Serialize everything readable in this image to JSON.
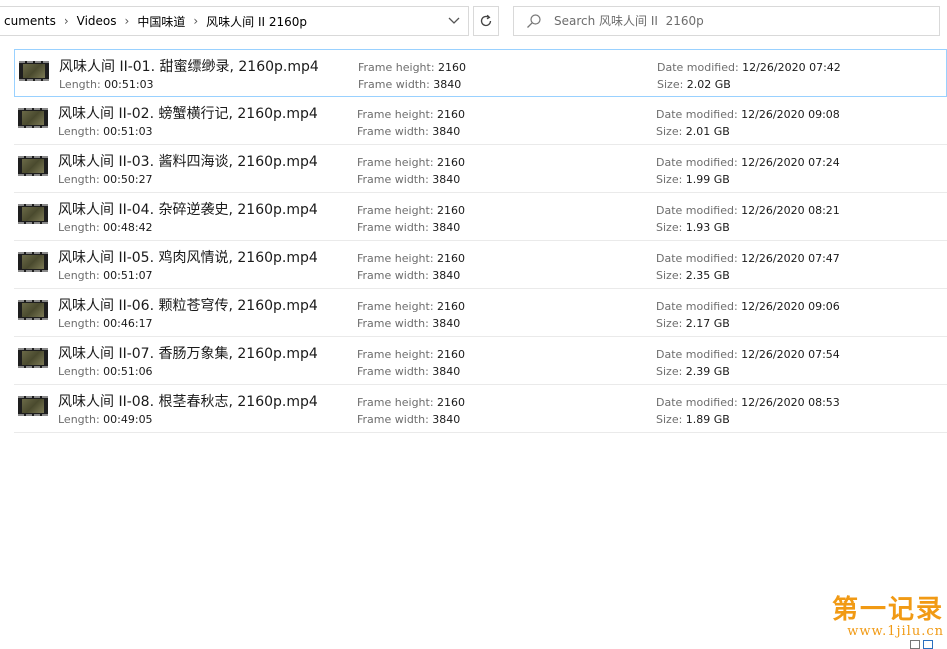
{
  "address": {
    "crumbs": [
      "cuments",
      "Videos",
      "中国味道",
      "风味人间 II  2160p"
    ],
    "separator": "›",
    "dropdown_icon": "chevron-down-icon",
    "refresh_icon": "refresh-icon"
  },
  "search": {
    "placeholder": "Search 风味人间 II  2160p",
    "value": ""
  },
  "labels": {
    "length": "Length:",
    "frame_height": "Frame height:",
    "frame_width": "Frame width:",
    "date_modified": "Date modified:",
    "size": "Size:"
  },
  "files": [
    {
      "name": "风味人间 II-01. 甜蜜缥缈录, 2160p.mp4",
      "length": "00:51:03",
      "frame_height": "2160",
      "frame_width": "3840",
      "date_modified": "12/26/2020 07:42",
      "size": "2.02 GB",
      "selected": true
    },
    {
      "name": "风味人间 II-02. 螃蟹横行记, 2160p.mp4",
      "length": "00:51:03",
      "frame_height": "2160",
      "frame_width": "3840",
      "date_modified": "12/26/2020 09:08",
      "size": "2.01 GB",
      "selected": false
    },
    {
      "name": "风味人间 II-03. 酱料四海谈, 2160p.mp4",
      "length": "00:50:27",
      "frame_height": "2160",
      "frame_width": "3840",
      "date_modified": "12/26/2020 07:24",
      "size": "1.99 GB",
      "selected": false
    },
    {
      "name": "风味人间 II-04. 杂碎逆袭史, 2160p.mp4",
      "length": "00:48:42",
      "frame_height": "2160",
      "frame_width": "3840",
      "date_modified": "12/26/2020 08:21",
      "size": "1.93 GB",
      "selected": false
    },
    {
      "name": "风味人间 II-05. 鸡肉风情说, 2160p.mp4",
      "length": "00:51:07",
      "frame_height": "2160",
      "frame_width": "3840",
      "date_modified": "12/26/2020 07:47",
      "size": "2.35 GB",
      "selected": false
    },
    {
      "name": "风味人间 II-06. 颗粒苍穹传, 2160p.mp4",
      "length": "00:46:17",
      "frame_height": "2160",
      "frame_width": "3840",
      "date_modified": "12/26/2020 09:06",
      "size": "2.17 GB",
      "selected": false
    },
    {
      "name": "风味人间 II-07. 香肠万象集, 2160p.mp4",
      "length": "00:51:06",
      "frame_height": "2160",
      "frame_width": "3840",
      "date_modified": "12/26/2020 07:54",
      "size": "2.39 GB",
      "selected": false
    },
    {
      "name": "风味人间 II-08. 根茎春秋志, 2160p.mp4",
      "length": "00:49:05",
      "frame_height": "2160",
      "frame_width": "3840",
      "date_modified": "12/26/2020 08:53",
      "size": "1.89 GB",
      "selected": false
    }
  ],
  "watermark": {
    "title": "第一记录",
    "url": "www.1jilu.cn",
    "color": "#f19a14"
  },
  "colors": {
    "selection_border": "#99d1ff",
    "label_gray": "#6d6d6d"
  }
}
